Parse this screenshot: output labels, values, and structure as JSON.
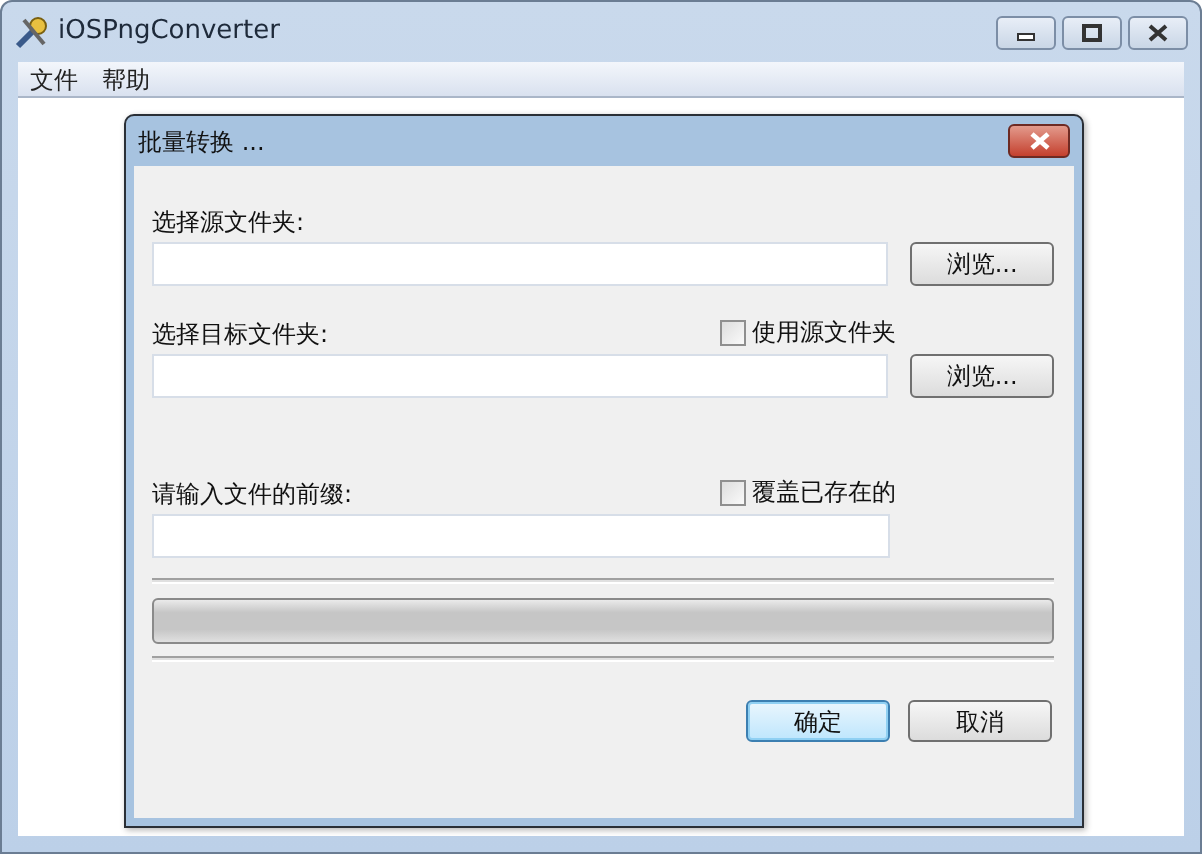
{
  "window": {
    "title": "iOSPngConverter"
  },
  "menu": [
    "文件",
    "帮助"
  ],
  "dialog": {
    "title": "批量转换 ...",
    "source": {
      "label": "选择源文件夹:",
      "browse": "浏览..."
    },
    "target": {
      "label": "选择目标文件夹:",
      "option": {
        "label": "使用源文件夹",
        "checked": false
      },
      "browse": "浏览..."
    },
    "prefix": {
      "label": "请输入文件的前缀:",
      "option": {
        "label": "覆盖已存在的",
        "checked": false
      }
    },
    "progress": {
      "level": 0
    },
    "buttons": [
      {
        "label": "确定",
        "default": true
      },
      {
        "label": "取消",
        "default": false
      }
    ]
  }
}
